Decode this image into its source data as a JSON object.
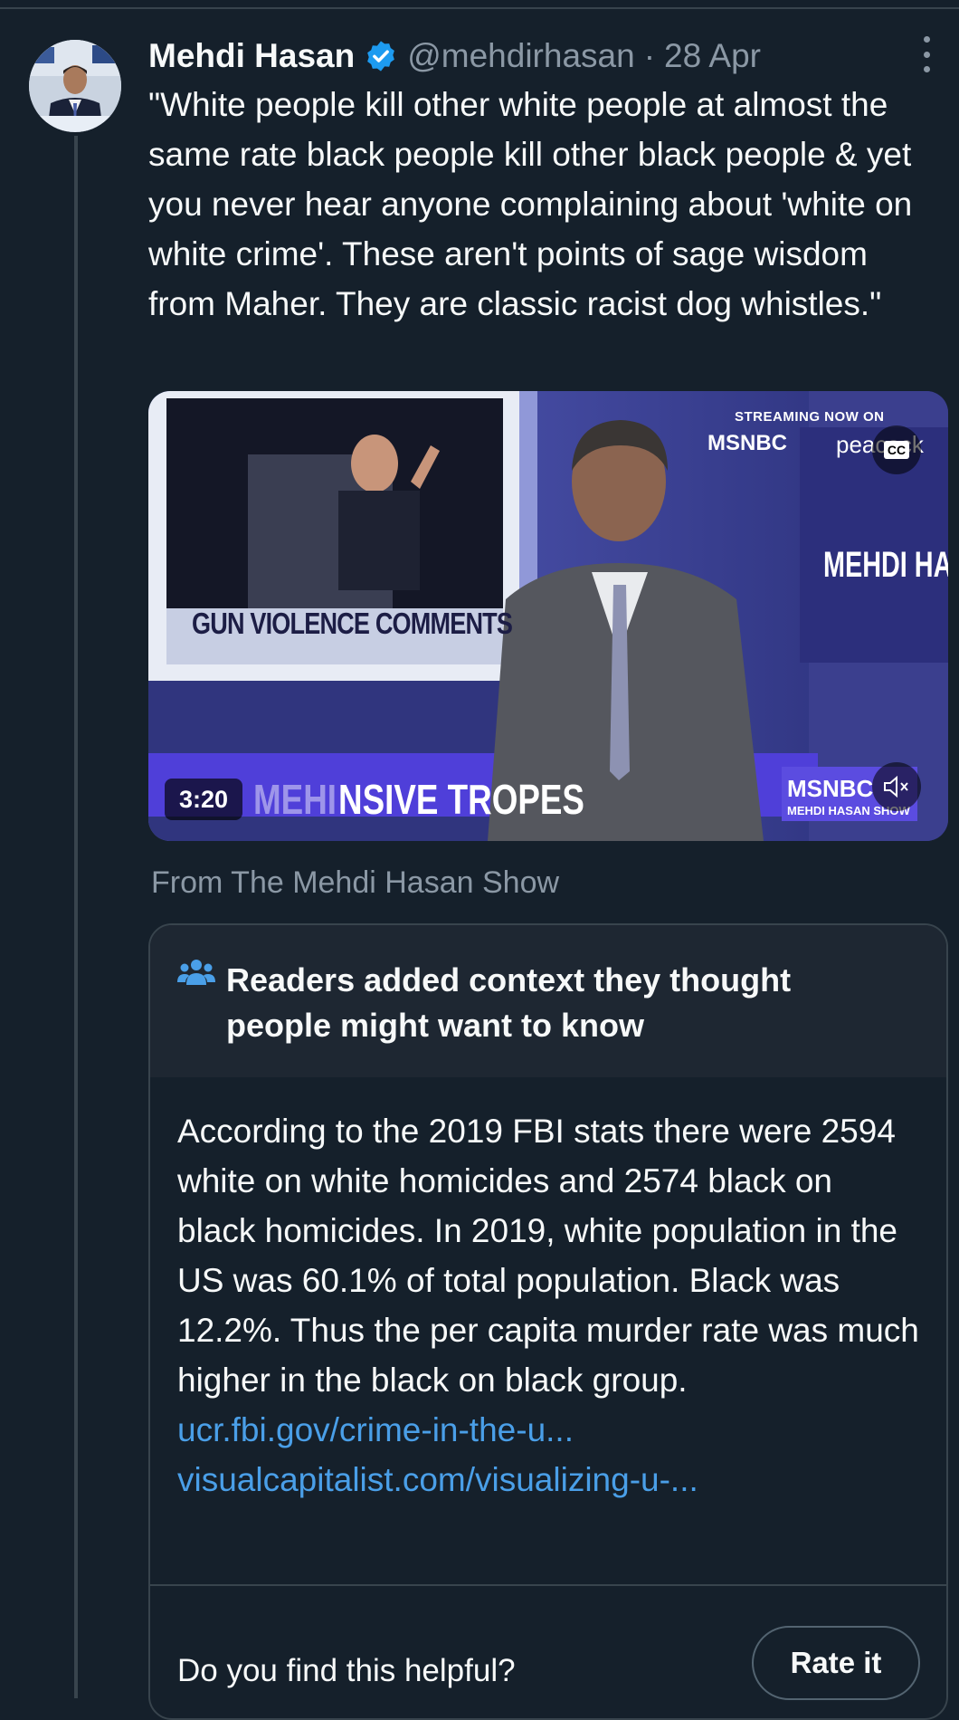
{
  "tweet": {
    "author_name": "Mehdi Hasan",
    "handle": "@mehdirhasan",
    "separator": "·",
    "date": "28 Apr",
    "text": "\"White people kill other white people at almost the same rate black people kill other black people & yet you never hear anyone complaining about 'white on white crime'. These aren't points of sage wisdom from Maher. They are classic racist dog whistles.\""
  },
  "video": {
    "duration": "3:20",
    "streaming_text": "STREAMING NOW ON",
    "network_top": "MSNBC",
    "peacock": "peacock",
    "caption_button": "CC",
    "lower_third_left": "GUN VIOLENCE COMMENTS",
    "side_title": "MEHDI HA SI",
    "chyron_ghost": "MEHI",
    "chyron": "NSIVE TROPES",
    "network_bottom": "MSNBC",
    "show_bottom": "MEHDI HASAN SHOW",
    "source_prefix": "From",
    "source_name": "The Mehdi Hasan Show"
  },
  "community_note": {
    "title": "Readers added context they thought people might want to know",
    "body": "According to the 2019 FBI stats there were 2594 white on white homicides and 2574 black on black homicides. In 2019, white population in the US was 60.1% of total population. Black was 12.2%. Thus the per capita murder rate was much higher in the black on black group.",
    "link1": "ucr.fbi.gov/crime-in-the-u...",
    "link2": "visualcapitalist.com/visualizing-u-...",
    "question": "Do you find this helpful?",
    "rate_button": "Rate it"
  },
  "colors": {
    "background": "#15202b",
    "link": "#4a9fe8",
    "verified": "#1d9bf0",
    "muted_text": "#8b98a5"
  },
  "icons": [
    "verified-badge-icon",
    "more-icon",
    "people-icon",
    "cc-icon",
    "mute-icon"
  ]
}
